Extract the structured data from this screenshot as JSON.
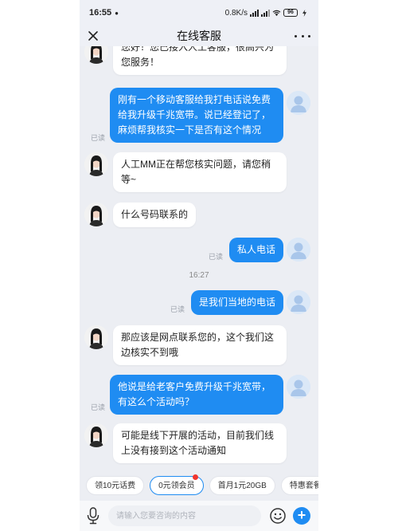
{
  "status_bar": {
    "time": "16:55",
    "time_dot": "●",
    "network_speed": "0.8K/s",
    "battery": "96"
  },
  "nav": {
    "title": "在线客服"
  },
  "messages": [
    {
      "from": "agent",
      "text": "您好！您已接入人工客服，很高兴为您服务！"
    },
    {
      "from": "user",
      "text": "刚有一个移动客服给我打电话说免费给我升级千兆宽带。说已经登记了，麻烦帮我核实一下是否有这个情况",
      "read": "已读"
    },
    {
      "from": "agent",
      "text": "人工MM正在帮您核实问题，请您稍等~"
    },
    {
      "from": "agent",
      "text": "什么号码联系的"
    },
    {
      "from": "user",
      "text": "私人电话",
      "read": "已读"
    },
    {
      "from": "user",
      "text": "是我们当地的电话",
      "read": "已读"
    },
    {
      "from": "agent",
      "text": "那应该是网点联系您的，这个我们这边核实不到哦"
    },
    {
      "from": "user",
      "text": "他说是给老客户免费升级千兆宽带，有这么个活动吗？",
      "read": "已读"
    },
    {
      "from": "agent",
      "text": "可能是线下开展的活动，目前我们线上没有接到这个活动通知"
    }
  ],
  "time_separator": "16:27",
  "quick_replies": [
    "领10元话费",
    "0元领会员",
    "首月1元20GB",
    "特惠套餐"
  ],
  "input": {
    "placeholder": "请输入您要咨询的内容",
    "value": ""
  },
  "colors": {
    "accent": "#1f8cf2",
    "badge": "#f0362f"
  }
}
